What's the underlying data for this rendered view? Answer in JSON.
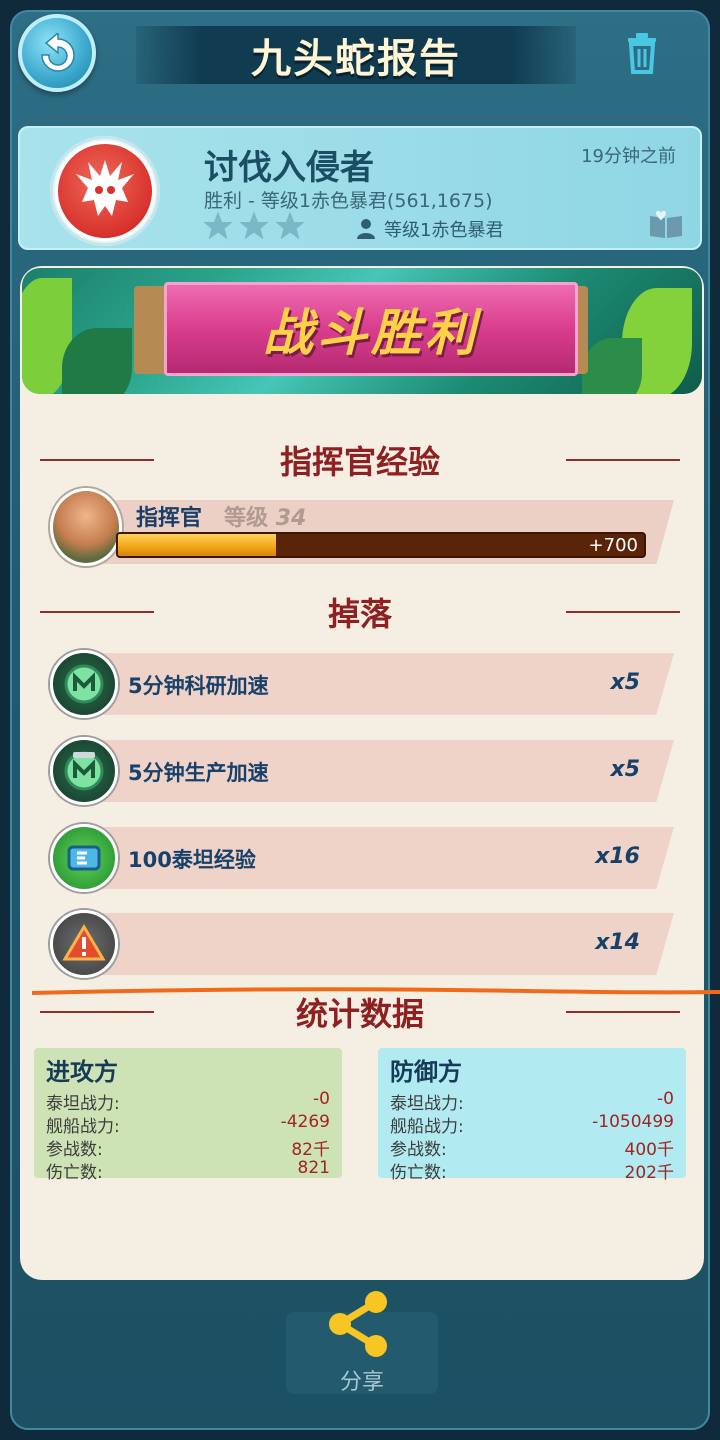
{
  "header": {
    "title": "九头蛇报告"
  },
  "report": {
    "title": "讨伐入侵者",
    "subtitle": "胜利 - 等级1赤色暴君(561,1675)",
    "time": "19分钟之前",
    "stars": 3,
    "owner": "等级1赤色暴君"
  },
  "banner": {
    "text": "战斗胜利"
  },
  "commander_section": {
    "heading": "指挥官经验",
    "name": "指挥官",
    "level_label": "等级",
    "level_value": "34",
    "xp_gain": "+700",
    "xp_progress": 0.3
  },
  "loot_section": {
    "heading": "掉落",
    "items": [
      {
        "name": "5分钟科研加速",
        "qty": "x5",
        "icon": "research-speedup-icon"
      },
      {
        "name": "5分钟生产加速",
        "qty": "x5",
        "icon": "production-speedup-icon"
      },
      {
        "name": "100泰坦经验",
        "qty": "x16",
        "icon": "titan-exp-icon"
      },
      {
        "name": "",
        "qty": "x14",
        "icon": "warning-icon"
      }
    ]
  },
  "stats_section": {
    "heading": "统计数据",
    "attacker": {
      "title": "进攻方",
      "rows": [
        {
          "label": "泰坦战力:",
          "value": "-0"
        },
        {
          "label": "舰船战力:",
          "value": "-4269"
        },
        {
          "label": "参战数:",
          "value": "82千"
        },
        {
          "label": "伤亡数:",
          "value": "821"
        }
      ]
    },
    "defender": {
      "title": "防御方",
      "rows": [
        {
          "label": "泰坦战力:",
          "value": "-0"
        },
        {
          "label": "舰船战力:",
          "value": "-1050499"
        },
        {
          "label": "参战数:",
          "value": "400千"
        },
        {
          "label": "伤亡数:",
          "value": "202千"
        }
      ]
    }
  },
  "share": {
    "label": "分享"
  },
  "colors": {
    "accent_red": "#8e2021",
    "frame_teal": "#215b70",
    "paper": "#f5efe3",
    "annotation_orange": "#f06a1c"
  }
}
